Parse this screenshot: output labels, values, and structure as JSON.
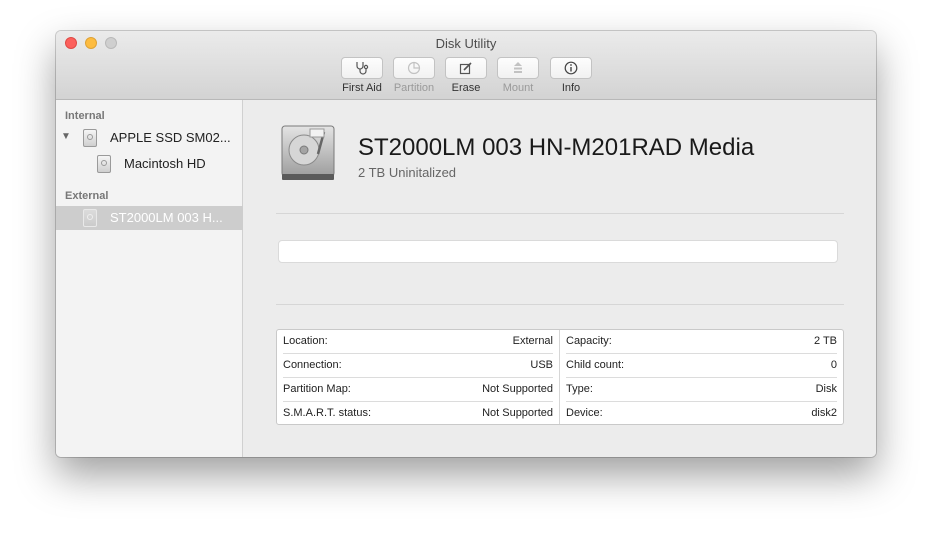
{
  "window": {
    "title": "Disk Utility"
  },
  "toolbar": {
    "items": [
      {
        "label": "First Aid",
        "icon": "stethoscope-icon",
        "enabled": true
      },
      {
        "label": "Partition",
        "icon": "pie-chart-icon",
        "enabled": false
      },
      {
        "label": "Erase",
        "icon": "pencil-box-icon",
        "enabled": true
      },
      {
        "label": "Mount",
        "icon": "mount-icon",
        "enabled": false
      },
      {
        "label": "Info",
        "icon": "info-icon",
        "enabled": true
      }
    ]
  },
  "sidebar": {
    "sections": [
      {
        "header": "Internal",
        "items": [
          {
            "label": "APPLE SSD SM02...",
            "level": 0,
            "expanded": true
          },
          {
            "label": "Macintosh HD",
            "level": 1
          }
        ]
      },
      {
        "header": "External",
        "items": [
          {
            "label": "ST2000LM 003 H...",
            "level": 0,
            "selected": true
          }
        ]
      }
    ]
  },
  "drive": {
    "name": "ST2000LM 003 HN-M201RAD Media",
    "subtitle": "2 TB Uninitalized"
  },
  "info": {
    "left": [
      {
        "key": "Location:",
        "value": "External"
      },
      {
        "key": "Connection:",
        "value": "USB"
      },
      {
        "key": "Partition Map:",
        "value": "Not Supported"
      },
      {
        "key": "S.M.A.R.T. status:",
        "value": "Not Supported"
      }
    ],
    "right": [
      {
        "key": "Capacity:",
        "value": "2 TB"
      },
      {
        "key": "Child count:",
        "value": "0"
      },
      {
        "key": "Type:",
        "value": "Disk"
      },
      {
        "key": "Device:",
        "value": "disk2"
      }
    ]
  },
  "colors": {
    "close": "#fc605c",
    "minimize": "#fdbc40",
    "zoom-disabled": "#cfcfcf",
    "selection": "#cdcdcd"
  }
}
